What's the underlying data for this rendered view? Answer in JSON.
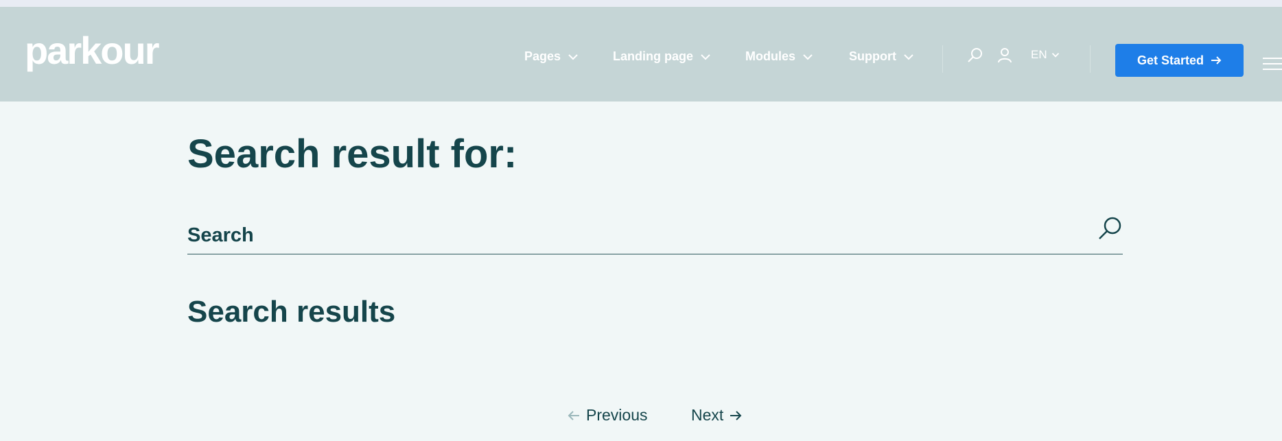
{
  "header": {
    "logo": "parkour",
    "nav": [
      {
        "label": "Pages"
      },
      {
        "label": "Landing page"
      },
      {
        "label": "Modules"
      },
      {
        "label": "Support"
      }
    ],
    "language": "EN",
    "cta_label": "Get Started"
  },
  "main": {
    "title": "Search result for:",
    "search_placeholder": "Search",
    "results_heading": "Search results"
  },
  "pagination": {
    "previous_label": "Previous",
    "next_label": "Next"
  },
  "colors": {
    "header_bg": "#c5d5d6",
    "page_bg": "#f1f7f7",
    "text_dark": "#15454b",
    "accent": "#1e7ee8"
  }
}
